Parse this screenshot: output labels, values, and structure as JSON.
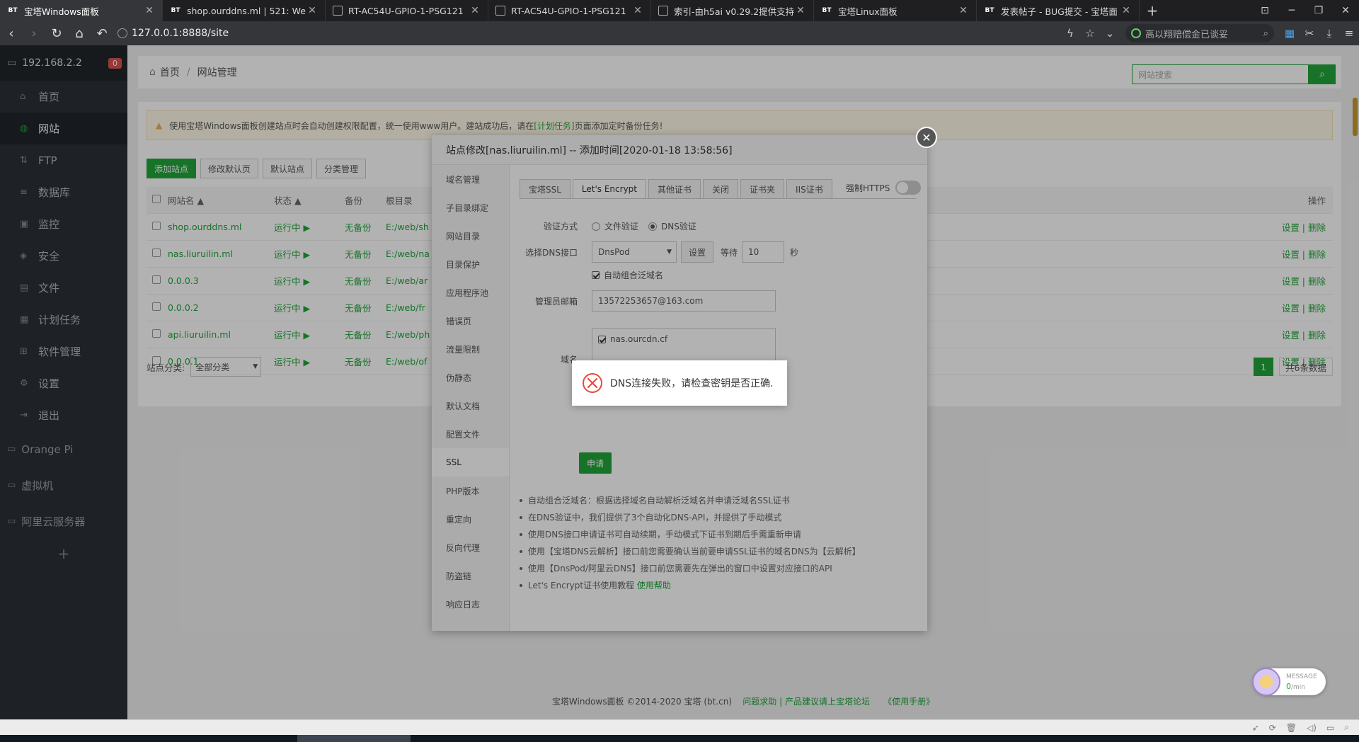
{
  "browser": {
    "tabs": [
      {
        "icon": "BT",
        "title": "宝塔Windows面板",
        "active": true
      },
      {
        "icon": "BT",
        "title": "shop.ourddns.ml | 521: We",
        "active": false
      },
      {
        "icon": "page",
        "title": "RT-AC54U-GPIO-1-PSG121",
        "active": false
      },
      {
        "icon": "page",
        "title": "RT-AC54U-GPIO-1-PSG121",
        "active": false
      },
      {
        "icon": "folder",
        "title": "索引-由h5ai v0.29.2提供支持",
        "active": false
      },
      {
        "icon": "BT",
        "title": "宝塔Linux面板",
        "active": false
      },
      {
        "icon": "BT",
        "title": "发表帖子 - BUG提交 - 宝塔面",
        "active": false
      }
    ],
    "url": "127.0.0.1:8888/site",
    "search_text": "高以翔赔偿金已谈妥"
  },
  "sidebar": {
    "host": "192.168.2.2",
    "badge": "0",
    "items": [
      {
        "label": "首页",
        "icon": "home-icon",
        "active": false
      },
      {
        "label": "网站",
        "icon": "globe-icon",
        "active": true
      },
      {
        "label": "FTP",
        "icon": "ftp-icon",
        "active": false
      },
      {
        "label": "数据库",
        "icon": "database-icon",
        "active": false
      },
      {
        "label": "监控",
        "icon": "monitor-icon",
        "active": false
      },
      {
        "label": "安全",
        "icon": "shield-icon",
        "active": false
      },
      {
        "label": "文件",
        "icon": "file-icon",
        "active": false
      },
      {
        "label": "计划任务",
        "icon": "calendar-icon",
        "active": false
      },
      {
        "label": "软件管理",
        "icon": "grid-icon",
        "active": false
      },
      {
        "label": "设置",
        "icon": "gear-icon",
        "active": false
      },
      {
        "label": "退出",
        "icon": "logout-icon",
        "active": false
      }
    ],
    "groups": [
      "Orange Pi",
      "虚拟机",
      "阿里云服务器"
    ]
  },
  "main": {
    "breadcrumb": [
      "首页",
      "网站管理"
    ],
    "search_placeholder": "网站搜索",
    "notice": {
      "prefix": "使用宝塔Windows面板创建站点时会自动创建权限配置，统一使用www用户。建站成功后，请在",
      "link": "[计划任务]",
      "suffix": "页面添加定时备份任务!"
    },
    "toolbar": [
      "添加站点",
      "修改默认页",
      "默认站点",
      "分类管理"
    ],
    "table": {
      "headers": {
        "name": "网站名",
        "status": "状态",
        "backup": "备份",
        "root": "根目录",
        "op": "操作"
      },
      "rows": [
        {
          "name": "shop.ourddns.ml",
          "status": "运行中 ▶",
          "backup": "无备份",
          "root": "E:/web/sh",
          "op": "设置 | 删除"
        },
        {
          "name": "nas.liuruilin.ml",
          "status": "运行中 ▶",
          "backup": "无备份",
          "root": "E:/web/na",
          "op": "设置 | 删除"
        },
        {
          "name": "0.0.0.3",
          "status": "运行中 ▶",
          "backup": "无备份",
          "root": "E:/web/ar",
          "op": "设置 | 删除"
        },
        {
          "name": "0.0.0.2",
          "status": "运行中 ▶",
          "backup": "无备份",
          "root": "E:/web/fr",
          "op": "设置 | 删除"
        },
        {
          "name": "api.liuruilin.ml",
          "status": "运行中 ▶",
          "backup": "无备份",
          "root": "E:/web/ph",
          "op": "设置 | 删除"
        },
        {
          "name": "0.0.0.1",
          "status": "运行中 ▶",
          "backup": "无备份",
          "root": "E:/web/of",
          "op": "设置 | 删除"
        }
      ]
    },
    "category_label": "站点分类:",
    "category_value": "全部分类",
    "page": "1",
    "total": "共6条数据",
    "footer": {
      "copyright": "宝塔Windows面板 ©2014-2020 宝塔 (bt.cn)",
      "links": "问题求助 | 产品建议请上宝塔论坛",
      "manual": "《使用手册》"
    }
  },
  "modal": {
    "title": "站点修改[nas.liuruilin.ml] -- 添加时间[2020-01-18 13:58:56]",
    "nav": [
      "域名管理",
      "子目录绑定",
      "网站目录",
      "目录保护",
      "应用程序池",
      "错误页",
      "流量限制",
      "伪静态",
      "默认文档",
      "配置文件",
      "SSL",
      "PHP版本",
      "重定向",
      "反向代理",
      "防盗链",
      "响应日志"
    ],
    "nav_active": "SSL",
    "tabs": [
      "宝塔SSL",
      "Let's Encrypt",
      "其他证书",
      "关闭",
      "证书夹",
      "IIS证书"
    ],
    "tab_active": "Let's Encrypt",
    "force_https": "强制HTTPS",
    "verify_label": "验证方式",
    "verify_file": "文件验证",
    "verify_dns": "DNS验证",
    "dns_label": "选择DNS接口",
    "dns_value": "DnsPod",
    "dns_settings": "设置",
    "wait_label": "等待",
    "wait_value": "10",
    "wait_unit": "秒",
    "auto_wildcard": "自动组合泛域名",
    "email_label": "管理员邮箱",
    "email_value": "13572253657@163.com",
    "domain_label": "域名",
    "domain_value": "nas.ourcdn.cf",
    "apply": "申请",
    "tips": [
      "自动组合泛域名：根据选择域名自动解析泛域名并申请泛域名SSL证书",
      "在DNS验证中，我们提供了3个自动化DNS-API，并提供了手动模式",
      "使用DNS接口申请证书可自动续期，手动模式下证书到期后手需重新申请",
      "使用【宝塔DNS云解析】接口前您需要确认当前要申请SSL证书的域名DNS为【云解析】",
      "使用【DnsPod/阿里云DNS】接口前您需要先在弹出的窗口中设置对应接口的API"
    ],
    "tip_last_prefix": "Let's Encrypt证书使用教程",
    "tip_last_link": "使用帮助"
  },
  "toast": {
    "message": "DNS连接失败，请检查密钥是否正确."
  },
  "message_widget": {
    "label": "MESSAGE",
    "rate_value": "0",
    "rate_unit": "/min"
  }
}
